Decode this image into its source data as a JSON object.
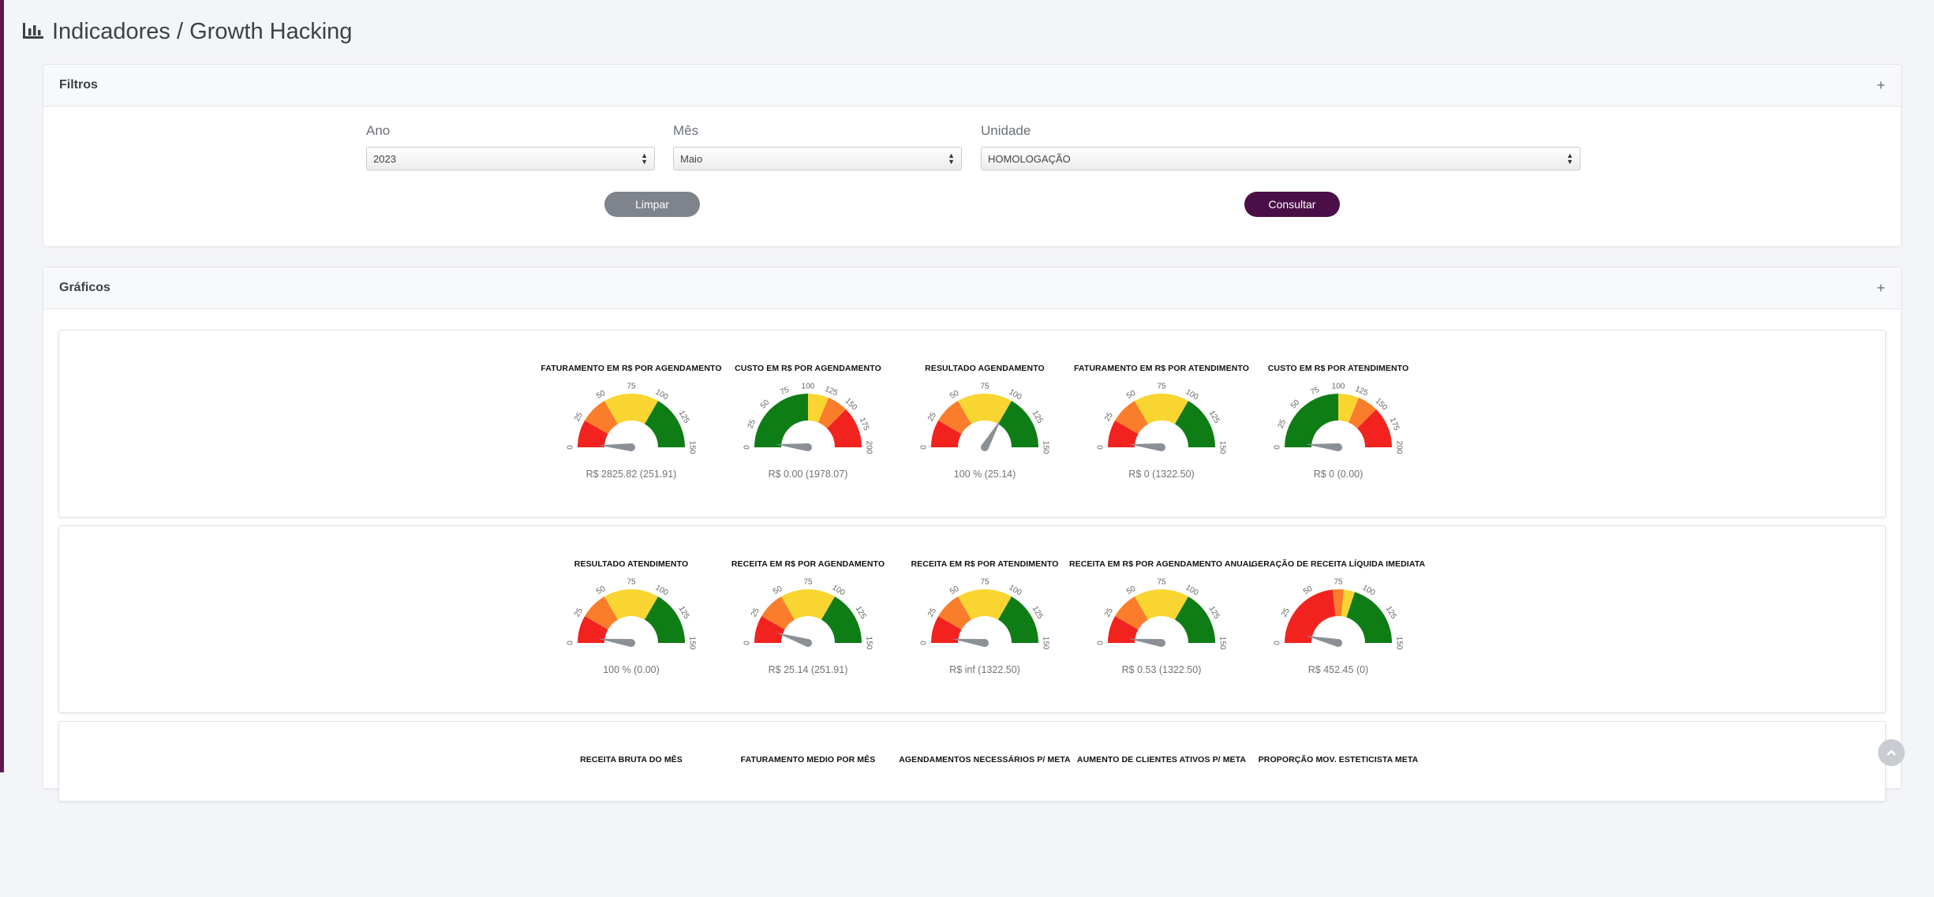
{
  "page": {
    "title": "Indicadores / Growth Hacking",
    "icon": "bar-chart-icon"
  },
  "filters": {
    "title": "Filtros",
    "toggle": "+",
    "ano": {
      "label": "Ano",
      "value": "2023"
    },
    "mes": {
      "label": "Mês",
      "value": "Maio"
    },
    "unidade": {
      "label": "Unidade",
      "value": "HOMOLOGAÇÃO"
    },
    "clear_label": "Limpar",
    "submit_label": "Consultar"
  },
  "charts": {
    "title": "Gráficos",
    "toggle": "+",
    "colors": {
      "red": "#f2231f",
      "orange": "#f97d2b",
      "yellow": "#f8d531",
      "green": "#0f7d16",
      "needle": "#8a9096"
    },
    "rows": [
      [
        {
          "title": "FATURAMENTO EM R$ POR AGENDAMENTO",
          "value_text": "R$ 2825.82 (251.91)",
          "max": 150,
          "ticks": [
            "0",
            "25",
            "50",
            "75",
            "100",
            "125",
            "150"
          ],
          "needle_fraction": 0.02,
          "bands": [
            {
              "to": 0.1667,
              "color": "red"
            },
            {
              "to": 0.3333,
              "color": "orange"
            },
            {
              "to": 0.6667,
              "color": "yellow"
            },
            {
              "to": 1,
              "color": "green"
            }
          ]
        },
        {
          "title": "CUSTO EM R$ POR AGENDAMENTO",
          "value_text": "R$ 0.00 (1978.07)",
          "max": 200,
          "ticks": [
            "0",
            "25",
            "50",
            "75",
            "100",
            "125",
            "150",
            "175",
            "200"
          ],
          "needle_fraction": 0.03,
          "bands": [
            {
              "to": 0.5,
              "color": "green"
            },
            {
              "to": 0.625,
              "color": "yellow"
            },
            {
              "to": 0.75,
              "color": "orange"
            },
            {
              "to": 1,
              "color": "red"
            }
          ]
        },
        {
          "title": "RESULTADO AGENDAMENTO",
          "value_text": "100 % (25.14)",
          "max": 150,
          "ticks": [
            "0",
            "25",
            "50",
            "75",
            "100",
            "125",
            "150"
          ],
          "needle_fraction": 0.6667,
          "bands": [
            {
              "to": 0.1667,
              "color": "red"
            },
            {
              "to": 0.3333,
              "color": "orange"
            },
            {
              "to": 0.6667,
              "color": "yellow"
            },
            {
              "to": 1,
              "color": "green"
            }
          ]
        },
        {
          "title": "FATURAMENTO EM R$ POR ATENDIMENTO",
          "value_text": "R$ 0 (1322.50)",
          "max": 150,
          "ticks": [
            "0",
            "25",
            "50",
            "75",
            "100",
            "125",
            "150"
          ],
          "needle_fraction": 0.03,
          "bands": [
            {
              "to": 0.1667,
              "color": "red"
            },
            {
              "to": 0.3333,
              "color": "orange"
            },
            {
              "to": 0.6667,
              "color": "yellow"
            },
            {
              "to": 1,
              "color": "green"
            }
          ]
        },
        {
          "title": "CUSTO EM R$ POR ATENDIMENTO",
          "value_text": "R$ 0 (0.00)",
          "max": 200,
          "ticks": [
            "0",
            "25",
            "50",
            "75",
            "100",
            "125",
            "150",
            "175",
            "200"
          ],
          "needle_fraction": 0.03,
          "bands": [
            {
              "to": 0.5,
              "color": "green"
            },
            {
              "to": 0.625,
              "color": "yellow"
            },
            {
              "to": 0.75,
              "color": "orange"
            },
            {
              "to": 1,
              "color": "red"
            }
          ]
        }
      ],
      [
        {
          "title": "RESULTADO ATENDIMENTO",
          "value_text": "100 % (0.00)",
          "max": 150,
          "ticks": [
            "0",
            "25",
            "50",
            "75",
            "100",
            "125",
            "150"
          ],
          "needle_fraction": 0.04,
          "bands": [
            {
              "to": 0.1667,
              "color": "red"
            },
            {
              "to": 0.3333,
              "color": "orange"
            },
            {
              "to": 0.6667,
              "color": "yellow"
            },
            {
              "to": 1,
              "color": "green"
            }
          ]
        },
        {
          "title": "RECEITA EM R$ POR AGENDAMENTO",
          "value_text": "R$ 25.14 (251.91)",
          "max": 150,
          "ticks": [
            "0",
            "25",
            "50",
            "75",
            "100",
            "125",
            "150"
          ],
          "needle_fraction": 0.1,
          "bands": [
            {
              "to": 0.1667,
              "color": "red"
            },
            {
              "to": 0.3333,
              "color": "orange"
            },
            {
              "to": 0.6667,
              "color": "yellow"
            },
            {
              "to": 1,
              "color": "green"
            }
          ]
        },
        {
          "title": "RECEITA EM R$ POR ATENDIMENTO",
          "value_text": "R$ inf (1322.50)",
          "max": 150,
          "ticks": [
            "0",
            "25",
            "50",
            "75",
            "100",
            "125",
            "150"
          ],
          "needle_fraction": 0.04,
          "bands": [
            {
              "to": 0.1667,
              "color": "red"
            },
            {
              "to": 0.3333,
              "color": "orange"
            },
            {
              "to": 0.6667,
              "color": "yellow"
            },
            {
              "to": 1,
              "color": "green"
            }
          ]
        },
        {
          "title": "RECEITA EM R$ POR AGENDAMENTO ANUAL",
          "value_text": "R$ 0.53 (1322.50)",
          "max": 150,
          "ticks": [
            "0",
            "25",
            "50",
            "75",
            "100",
            "125",
            "150"
          ],
          "needle_fraction": 0.04,
          "bands": [
            {
              "to": 0.1667,
              "color": "red"
            },
            {
              "to": 0.3333,
              "color": "orange"
            },
            {
              "to": 0.6667,
              "color": "yellow"
            },
            {
              "to": 1,
              "color": "green"
            }
          ]
        },
        {
          "title": "GERAÇÃO DE RECEITA LÍQUIDA IMEDIATA",
          "value_text": "R$ 452.45 (0)",
          "max": 150,
          "ticks": [
            "0",
            "25",
            "50",
            "75",
            "100",
            "125",
            "150"
          ],
          "needle_fraction": 0.07,
          "bands": [
            {
              "to": 0.4667,
              "color": "red"
            },
            {
              "to": 0.5333,
              "color": "orange"
            },
            {
              "to": 0.6,
              "color": "yellow"
            },
            {
              "to": 1,
              "color": "green"
            }
          ]
        }
      ],
      [
        {
          "title": "RECEITA BRUTA DO MÊS"
        },
        {
          "title": "FATURAMENTO MEDIO POR MÊS"
        },
        {
          "title": "AGENDAMENTOS NECESSÁRIOS P/ META"
        },
        {
          "title": "AUMENTO DE CLIENTES ATIVOS P/ META"
        },
        {
          "title": "PROPORÇÃO MOV. ESTETICISTA META"
        }
      ]
    ]
  }
}
